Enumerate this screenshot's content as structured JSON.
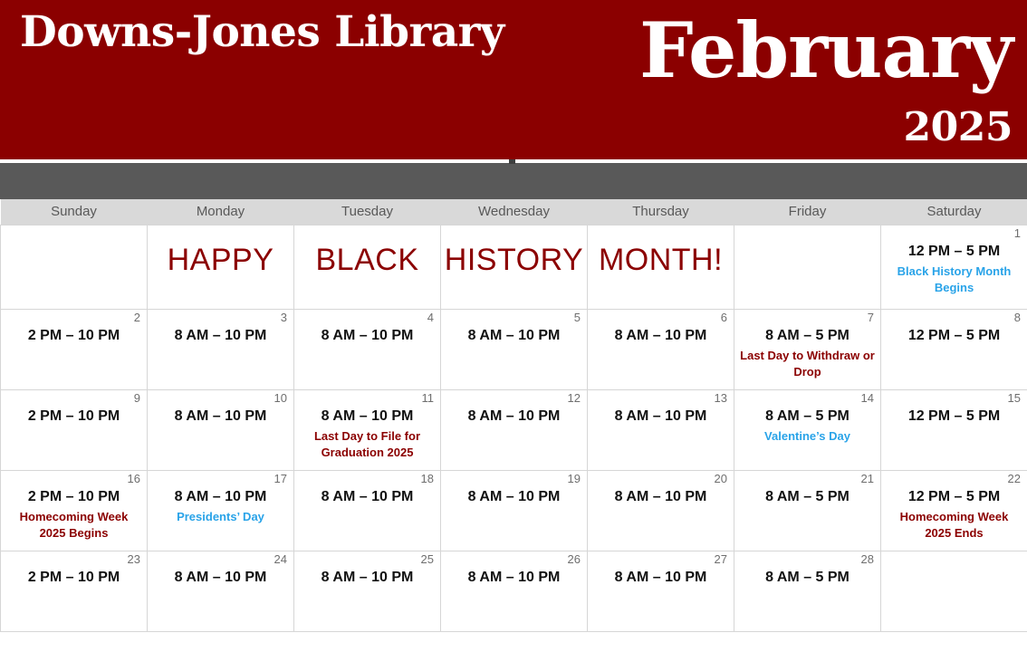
{
  "masthead": {
    "library_name": "Downs-Jones Library",
    "month": "February",
    "year": "2025",
    "background_color": "#8b0000",
    "text_color": "#ffffff"
  },
  "toolbar": {
    "band_color": "#595959"
  },
  "weekday_headers": [
    "Sunday",
    "Monday",
    "Tuesday",
    "Wednesday",
    "Thursday",
    "Friday",
    "Saturday"
  ],
  "colors": {
    "brand_red": "#8b0000",
    "event_red": "#8b0000",
    "event_blue": "#29a3e8",
    "header_row_bg": "#d9d9d9",
    "daynum_gray": "#6e6e6e",
    "cell_border": "#d6d6d6"
  },
  "banner": {
    "words": [
      "HAPPY",
      "BLACK",
      "HISTORY",
      "MONTH!"
    ]
  },
  "weeks": [
    {
      "days": [
        {
          "num": "",
          "hours": "",
          "event": "",
          "event_color": "",
          "banner": ""
        },
        {
          "num": "",
          "hours": "",
          "event": "",
          "event_color": "",
          "banner": "HAPPY"
        },
        {
          "num": "",
          "hours": "",
          "event": "",
          "event_color": "",
          "banner": "BLACK"
        },
        {
          "num": "",
          "hours": "",
          "event": "",
          "event_color": "",
          "banner": "HISTORY"
        },
        {
          "num": "",
          "hours": "",
          "event": "",
          "event_color": "",
          "banner": "MONTH!"
        },
        {
          "num": "",
          "hours": "",
          "event": "",
          "event_color": "",
          "banner": ""
        },
        {
          "num": "1",
          "hours": "12 PM – 5 PM",
          "event": "Black History Month Begins",
          "event_color": "blue",
          "banner": ""
        }
      ]
    },
    {
      "days": [
        {
          "num": "2",
          "hours": "2 PM – 10 PM",
          "event": "",
          "event_color": "",
          "banner": ""
        },
        {
          "num": "3",
          "hours": "8 AM – 10 PM",
          "event": "",
          "event_color": "",
          "banner": ""
        },
        {
          "num": "4",
          "hours": "8 AM – 10 PM",
          "event": "",
          "event_color": "",
          "banner": ""
        },
        {
          "num": "5",
          "hours": "8 AM – 10 PM",
          "event": "",
          "event_color": "",
          "banner": ""
        },
        {
          "num": "6",
          "hours": "8 AM – 10 PM",
          "event": "",
          "event_color": "",
          "banner": ""
        },
        {
          "num": "7",
          "hours": "8 AM – 5 PM",
          "event": "Last Day to Withdraw or Drop",
          "event_color": "red",
          "banner": ""
        },
        {
          "num": "8",
          "hours": "12 PM – 5 PM",
          "event": "",
          "event_color": "",
          "banner": ""
        }
      ]
    },
    {
      "days": [
        {
          "num": "9",
          "hours": "2 PM – 10 PM",
          "event": "",
          "event_color": "",
          "banner": ""
        },
        {
          "num": "10",
          "hours": "8 AM – 10 PM",
          "event": "",
          "event_color": "",
          "banner": ""
        },
        {
          "num": "11",
          "hours": "8 AM – 10 PM",
          "event": "Last Day to File for Graduation 2025",
          "event_color": "red",
          "banner": ""
        },
        {
          "num": "12",
          "hours": "8 AM – 10 PM",
          "event": "",
          "event_color": "",
          "banner": ""
        },
        {
          "num": "13",
          "hours": "8 AM – 10 PM",
          "event": "",
          "event_color": "",
          "banner": ""
        },
        {
          "num": "14",
          "hours": "8 AM – 5 PM",
          "event": "Valentine’s Day",
          "event_color": "blue",
          "banner": ""
        },
        {
          "num": "15",
          "hours": "12 PM – 5 PM",
          "event": "",
          "event_color": "",
          "banner": ""
        }
      ]
    },
    {
      "days": [
        {
          "num": "16",
          "hours": "2 PM – 10 PM",
          "event": "Homecoming Week 2025 Begins",
          "event_color": "red",
          "banner": ""
        },
        {
          "num": "17",
          "hours": "8 AM – 10 PM",
          "event": "Presidents’ Day",
          "event_color": "blue",
          "banner": ""
        },
        {
          "num": "18",
          "hours": "8 AM – 10 PM",
          "event": "",
          "event_color": "",
          "banner": ""
        },
        {
          "num": "19",
          "hours": "8 AM – 10 PM",
          "event": "",
          "event_color": "",
          "banner": ""
        },
        {
          "num": "20",
          "hours": "8 AM – 10 PM",
          "event": "",
          "event_color": "",
          "banner": ""
        },
        {
          "num": "21",
          "hours": "8 AM – 5 PM",
          "event": "",
          "event_color": "",
          "banner": ""
        },
        {
          "num": "22",
          "hours": "12 PM – 5 PM",
          "event": "Homecoming Week 2025 Ends",
          "event_color": "red",
          "banner": ""
        }
      ]
    },
    {
      "days": [
        {
          "num": "23",
          "hours": "2 PM – 10 PM",
          "event": "",
          "event_color": "",
          "banner": ""
        },
        {
          "num": "24",
          "hours": "8 AM – 10 PM",
          "event": "",
          "event_color": "",
          "banner": ""
        },
        {
          "num": "25",
          "hours": "8 AM – 10 PM",
          "event": "",
          "event_color": "",
          "banner": ""
        },
        {
          "num": "26",
          "hours": "8 AM – 10 PM",
          "event": "",
          "event_color": "",
          "banner": ""
        },
        {
          "num": "27",
          "hours": "8 AM – 10 PM",
          "event": "",
          "event_color": "",
          "banner": ""
        },
        {
          "num": "28",
          "hours": "8 AM – 5 PM",
          "event": "",
          "event_color": "",
          "banner": ""
        },
        {
          "num": "",
          "hours": "",
          "event": "",
          "event_color": "",
          "banner": ""
        }
      ]
    }
  ]
}
